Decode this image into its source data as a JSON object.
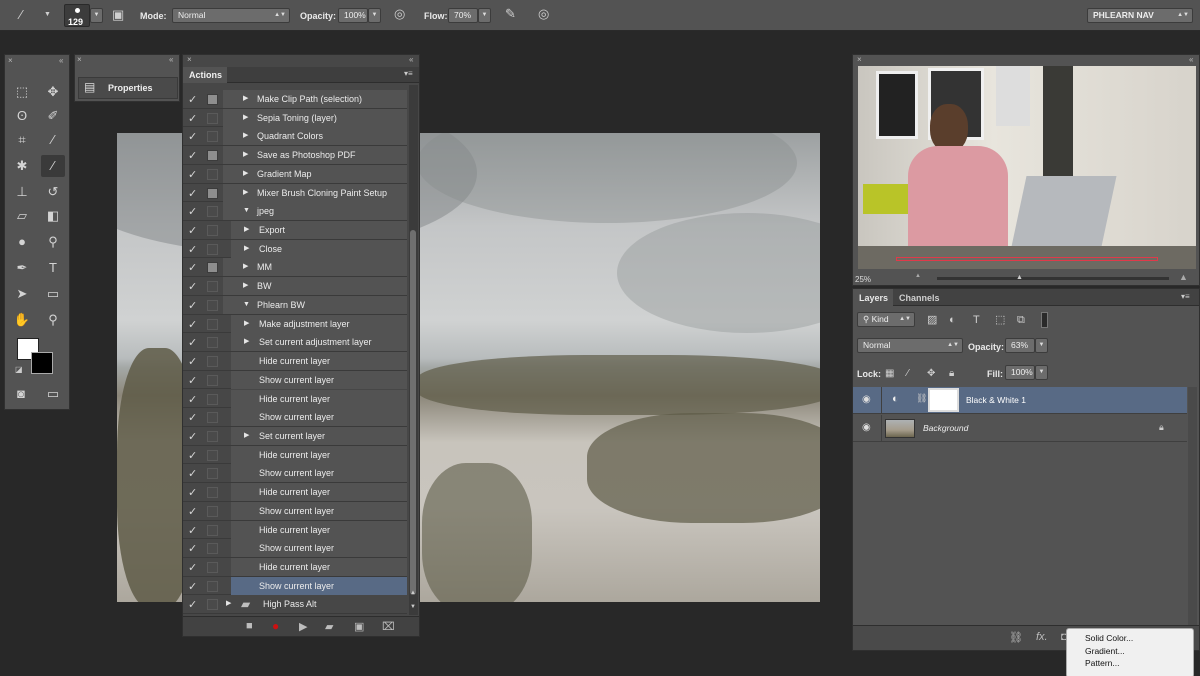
{
  "options_bar": {
    "brush_size": "129",
    "mode_label": "Mode:",
    "mode_value": "Normal",
    "opacity_label": "Opacity:",
    "opacity_value": "100%",
    "flow_label": "Flow:",
    "flow_value": "70%",
    "workspace": "PHLEARN NAV"
  },
  "properties_panel": {
    "title": "Properties"
  },
  "actions_panel": {
    "tab": "Actions",
    "rows": [
      {
        "label": "Make Clip Path (selection)",
        "dialog": true,
        "level": 0,
        "arrow": "right",
        "folder": false,
        "selected": false
      },
      {
        "label": "Sepia Toning (layer)",
        "dialog": false,
        "level": 0,
        "arrow": "right",
        "folder": false,
        "selected": false
      },
      {
        "label": "Quadrant Colors",
        "dialog": false,
        "level": 0,
        "arrow": "right",
        "folder": false,
        "selected": false
      },
      {
        "label": "Save as Photoshop PDF",
        "dialog": true,
        "level": 0,
        "arrow": "right",
        "folder": false,
        "selected": false
      },
      {
        "label": "Gradient Map",
        "dialog": false,
        "level": 0,
        "arrow": "right",
        "folder": false,
        "selected": false
      },
      {
        "label": "Mixer Brush Cloning Paint Setup",
        "dialog": true,
        "level": 0,
        "arrow": "right",
        "folder": false,
        "selected": false
      },
      {
        "label": "jpeg",
        "dialog": false,
        "level": 0,
        "arrow": "down",
        "folder": false,
        "selected": false
      },
      {
        "label": "Export",
        "dialog": false,
        "level": 1,
        "arrow": "right",
        "folder": false,
        "selected": false
      },
      {
        "label": "Close",
        "dialog": false,
        "level": 1,
        "arrow": "right",
        "folder": false,
        "selected": false
      },
      {
        "label": "MM",
        "dialog": true,
        "level": 0,
        "arrow": "right",
        "folder": false,
        "selected": false
      },
      {
        "label": "BW",
        "dialog": false,
        "level": 0,
        "arrow": "right",
        "folder": false,
        "selected": false
      },
      {
        "label": "Phlearn BW",
        "dialog": false,
        "level": 0,
        "arrow": "down",
        "folder": false,
        "selected": false
      },
      {
        "label": "Make adjustment layer",
        "dialog": false,
        "level": 1,
        "arrow": "right",
        "folder": false,
        "selected": false
      },
      {
        "label": "Set current adjustment layer",
        "dialog": false,
        "level": 1,
        "arrow": "right",
        "folder": false,
        "selected": false
      },
      {
        "label": "Hide current layer",
        "dialog": false,
        "level": 1,
        "arrow": "",
        "folder": false,
        "selected": false
      },
      {
        "label": "Show current layer",
        "dialog": false,
        "level": 1,
        "arrow": "",
        "folder": false,
        "selected": false
      },
      {
        "label": "Hide current layer",
        "dialog": false,
        "level": 1,
        "arrow": "",
        "folder": false,
        "selected": false
      },
      {
        "label": "Show current layer",
        "dialog": false,
        "level": 1,
        "arrow": "",
        "folder": false,
        "selected": false
      },
      {
        "label": "Set current layer",
        "dialog": false,
        "level": 1,
        "arrow": "right",
        "folder": false,
        "selected": false
      },
      {
        "label": "Hide current layer",
        "dialog": false,
        "level": 1,
        "arrow": "",
        "folder": false,
        "selected": false
      },
      {
        "label": "Show current layer",
        "dialog": false,
        "level": 1,
        "arrow": "",
        "folder": false,
        "selected": false
      },
      {
        "label": "Hide current layer",
        "dialog": false,
        "level": 1,
        "arrow": "",
        "folder": false,
        "selected": false
      },
      {
        "label": "Show current layer",
        "dialog": false,
        "level": 1,
        "arrow": "",
        "folder": false,
        "selected": false
      },
      {
        "label": "Hide current layer",
        "dialog": false,
        "level": 1,
        "arrow": "",
        "folder": false,
        "selected": false
      },
      {
        "label": "Show current layer",
        "dialog": false,
        "level": 1,
        "arrow": "",
        "folder": false,
        "selected": false
      },
      {
        "label": "Hide current layer",
        "dialog": false,
        "level": 1,
        "arrow": "",
        "folder": false,
        "selected": false
      },
      {
        "label": "Show current layer",
        "dialog": false,
        "level": 1,
        "arrow": "",
        "folder": false,
        "selected": true
      },
      {
        "label": "High Pass Alt",
        "dialog": false,
        "level": -1,
        "arrow": "right",
        "folder": true,
        "selected": false
      }
    ]
  },
  "video_panel": {
    "zoom": "25%"
  },
  "layers_panel": {
    "tabs": [
      "Layers",
      "Channels"
    ],
    "kind_filter": "Kind",
    "blend_mode": "Normal",
    "opacity_label": "Opacity:",
    "opacity_value": "63%",
    "lock_label": "Lock:",
    "fill_label": "Fill:",
    "fill_value": "100%",
    "layers": [
      {
        "name": "Black & White 1",
        "selected": true
      },
      {
        "name": "Background",
        "selected": false
      }
    ]
  },
  "fill_menu": {
    "items": [
      "Solid Color...",
      "Gradient...",
      "Pattern..."
    ]
  },
  "colors": {
    "panel": "#535353",
    "selection": "#586a85",
    "record": "#cc1111"
  }
}
